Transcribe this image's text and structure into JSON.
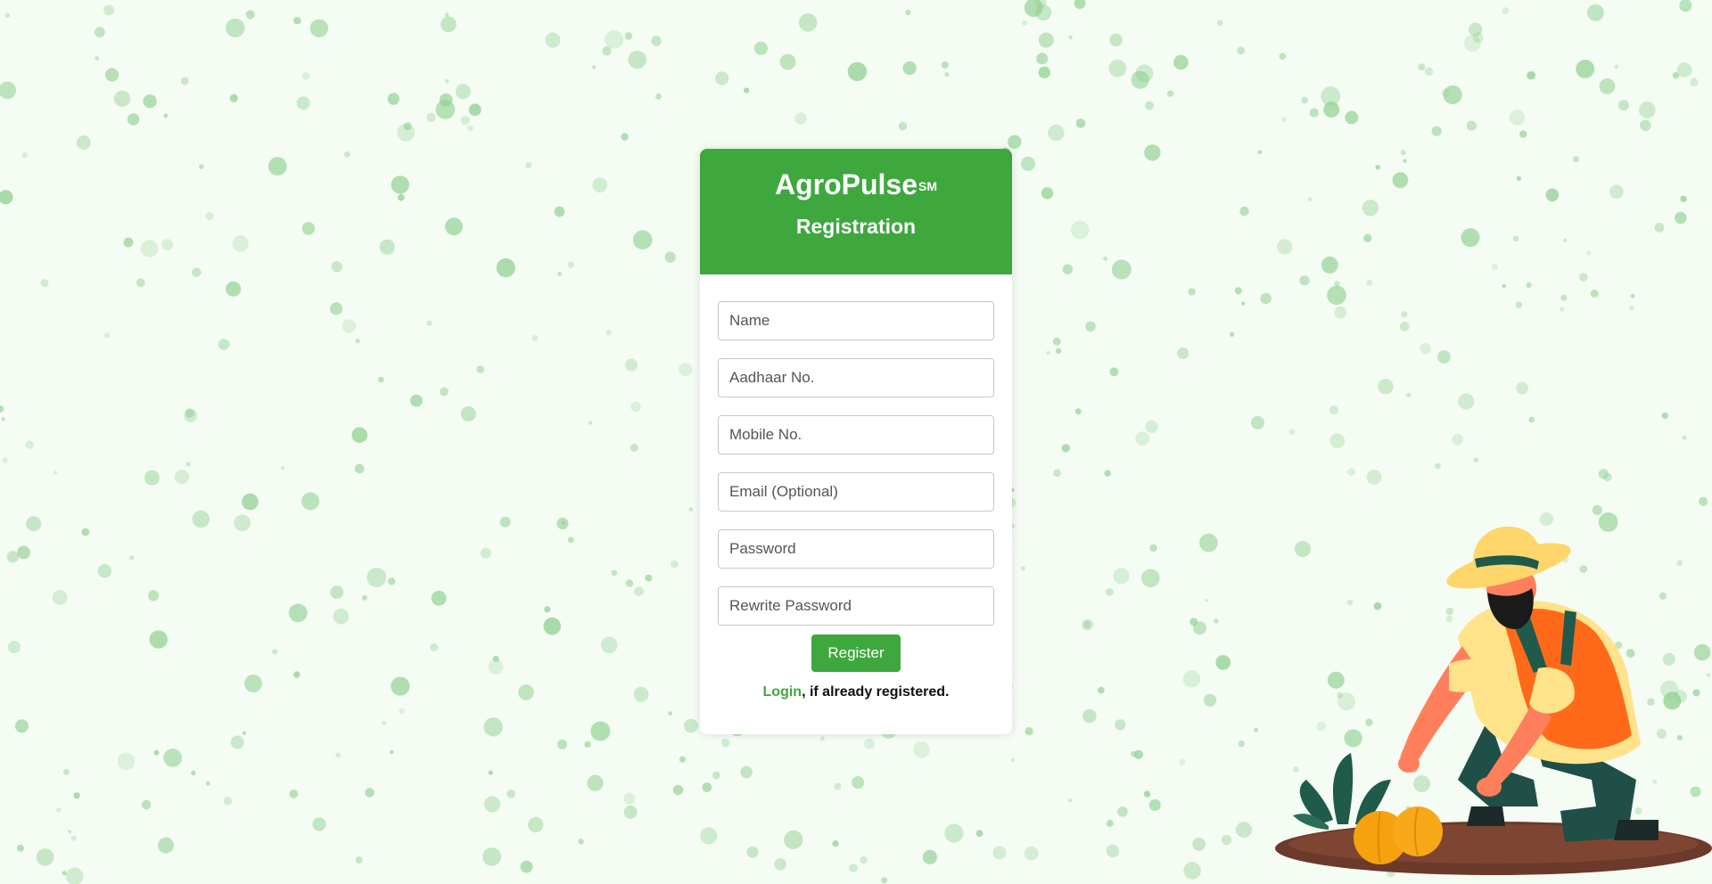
{
  "brand": {
    "name": "AgroPulse",
    "mark": "SM"
  },
  "header": {
    "subtitle": "Registration"
  },
  "form": {
    "fields": [
      {
        "name": "name",
        "placeholder": "Name",
        "value": ""
      },
      {
        "name": "aadhaar",
        "placeholder": "Aadhaar No.",
        "value": ""
      },
      {
        "name": "mobile",
        "placeholder": "Mobile No.",
        "value": ""
      },
      {
        "name": "email",
        "placeholder": "Email (Optional)",
        "value": ""
      },
      {
        "name": "password",
        "placeholder": "Password",
        "value": ""
      },
      {
        "name": "rewrite_password",
        "placeholder": "Rewrite Password",
        "value": ""
      }
    ],
    "register_label": "Register",
    "login_link": "Login",
    "login_suffix": ", if already registered."
  },
  "colors": {
    "accent": "#3ea83f",
    "background": "#f4fcf4",
    "dot": "#8fd08f"
  },
  "illustration": {
    "icon": "farmer-harvesting-icon"
  }
}
